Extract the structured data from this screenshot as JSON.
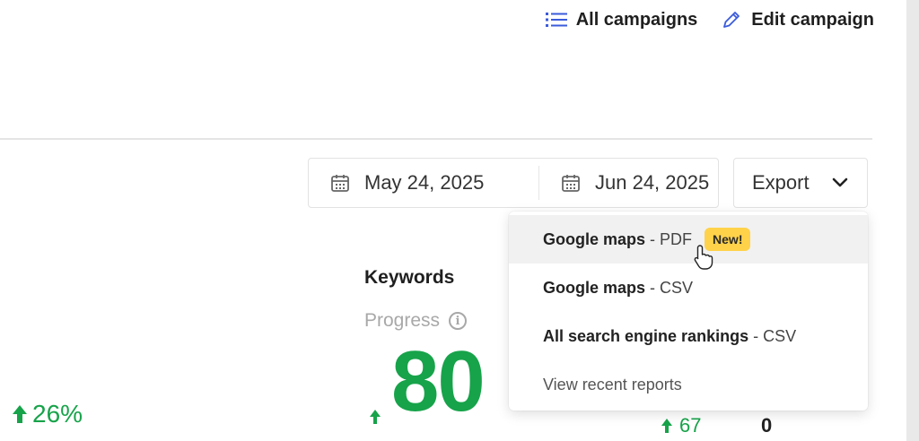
{
  "header": {
    "all_campaigns_label": "All campaigns",
    "edit_campaign_label": "Edit campaign"
  },
  "date_range": {
    "start": "May 24, 2025",
    "end": "Jun 24, 2025"
  },
  "export": {
    "label": "Export",
    "menu": [
      {
        "name": "Google maps",
        "format": "- PDF",
        "badge": "New!"
      },
      {
        "name": "Google maps",
        "format": "- CSV"
      },
      {
        "name": "All search engine rankings",
        "format": "- CSV"
      },
      {
        "label": "View recent reports"
      }
    ]
  },
  "keywords": {
    "title": "Keywords",
    "subtitle": "Progress",
    "value": "80"
  },
  "stats": {
    "left_change": "26%",
    "bottom_change": "67",
    "bottom_value": "0"
  },
  "colors": {
    "positive": "#17a34a",
    "badge": "#ffd24a",
    "nav_icon": "#3b5bdb"
  }
}
